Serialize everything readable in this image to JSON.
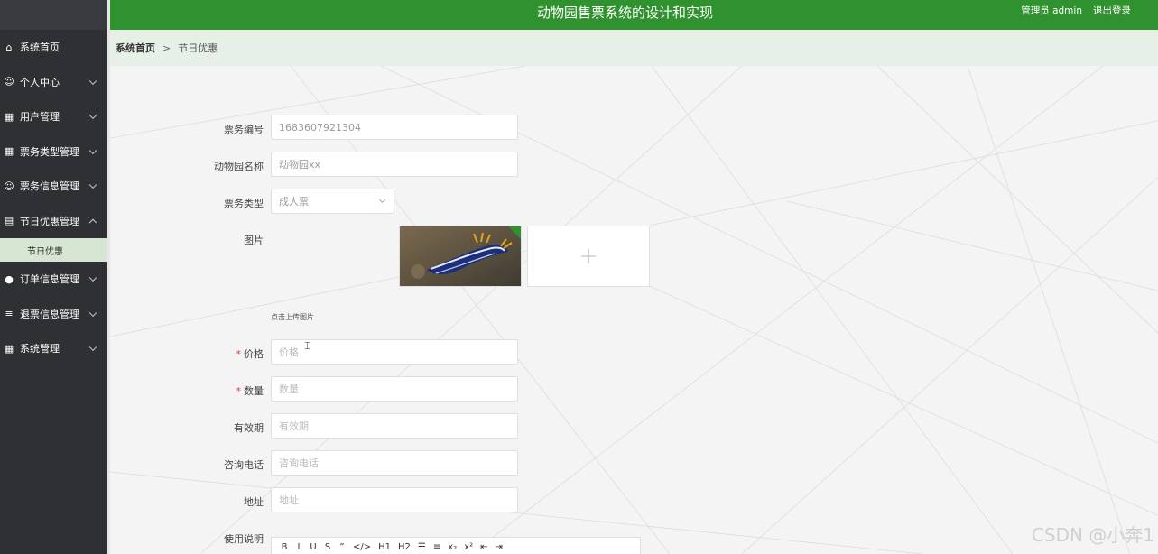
{
  "app": {
    "title": "动物园售票系统的设计和实现",
    "user_label": "管理员 admin",
    "logout_label": "退出登录"
  },
  "sidebar": {
    "items": [
      {
        "label": "系统首页",
        "icon": "home-icon",
        "expandable": false
      },
      {
        "label": "个人中心",
        "icon": "user-icon",
        "expandable": true
      },
      {
        "label": "用户管理",
        "icon": "grid-icon",
        "expandable": true
      },
      {
        "label": "票务类型管理",
        "icon": "grid-icon",
        "expandable": true
      },
      {
        "label": "票务信息管理",
        "icon": "user-icon",
        "expandable": true
      },
      {
        "label": "节日优惠管理",
        "icon": "gift-icon",
        "expandable": true,
        "expanded": true,
        "children": [
          {
            "label": "节日优惠",
            "active": true
          }
        ]
      },
      {
        "label": "订单信息管理",
        "icon": "bulb-icon",
        "expandable": true
      },
      {
        "label": "退票信息管理",
        "icon": "sliders-icon",
        "expandable": true
      },
      {
        "label": "系统管理",
        "icon": "grid-icon",
        "expandable": true
      }
    ]
  },
  "breadcrumb": {
    "home": "系统首页",
    "separator": ">",
    "current": "节日优惠"
  },
  "form": {
    "ticket_no": {
      "label": "票务编号",
      "value": "1683607921304"
    },
    "zoo_name": {
      "label": "动物园名称",
      "value": "动物园xx"
    },
    "ticket_type": {
      "label": "票务类型",
      "value": "成人票"
    },
    "image": {
      "label": "图片",
      "hint": "点击上传图片",
      "add": "+"
    },
    "price": {
      "label": "价格",
      "required": "*",
      "placeholder": "价格"
    },
    "quantity": {
      "label": "数量",
      "required": "*",
      "placeholder": "数量"
    },
    "validity": {
      "label": "有效期",
      "placeholder": "有效期"
    },
    "phone": {
      "label": "咨询电话",
      "placeholder": "咨询电话"
    },
    "address": {
      "label": "地址",
      "placeholder": "地址"
    },
    "instructions": {
      "label": "使用说明"
    }
  },
  "editor_toolbar": [
    "B",
    "I",
    "U",
    "S",
    "”",
    "</>",
    "H1",
    "H2",
    "☰",
    "≡",
    "x₂",
    "x²",
    "⇤",
    "⇥"
  ],
  "watermark": "CSDN @小奔1",
  "colors": {
    "header": "#2f922e",
    "sidebar": "#2f3033",
    "submenu_active": "#d6e6d3"
  }
}
